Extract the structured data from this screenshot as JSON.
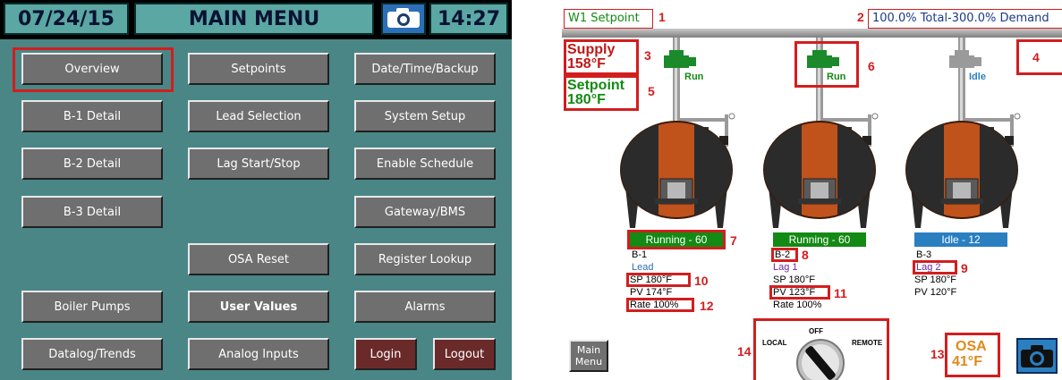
{
  "left_screen": {
    "topbar": {
      "date": "07/24/15",
      "title": "MAIN MENU",
      "camera_icon": "camera-icon",
      "time": "14:27"
    },
    "buttons": {
      "overview": "Overview",
      "setpoints": "Setpoints",
      "date_time_backup": "Date/Time/Backup",
      "b1_detail": "B-1 Detail",
      "lead_selection": "Lead Selection",
      "system_setup": "System Setup",
      "b2_detail": "B-2 Detail",
      "lag_start_stop": "Lag Start/Stop",
      "enable_schedule": "Enable Schedule",
      "b3_detail": "B-3 Detail",
      "gateway_bms": "Gateway/BMS",
      "osa_reset": "OSA Reset",
      "register_lookup": "Register Lookup",
      "boiler_pumps": "Boiler Pumps",
      "user_values": "User Values",
      "alarms": "Alarms",
      "datalog_trends": "Datalog/Trends",
      "analog_inputs": "Analog Inputs",
      "login": "Login",
      "logout": "Logout"
    },
    "selected": "Overview"
  },
  "right_screen": {
    "header_left": "W1 Setpoint",
    "header_right": "100.0% Total-300.0% Demand",
    "supply_label": "Supply",
    "supply_value": "158°F",
    "setpoint_label": "Setpoint",
    "setpoint_value": "180°F",
    "boilers": [
      {
        "valve_state": "Run",
        "status": "Running - 60",
        "status_color": "#138a13",
        "name": "B-1",
        "role": "Lead",
        "role_color": "#2a6fb8",
        "sp": "SP 180°F",
        "pv": "PV 174°F",
        "rate": "Rate 100%"
      },
      {
        "valve_state": "Run",
        "status": "Running - 60",
        "status_color": "#138a13",
        "name": "B-2",
        "role": "Lag 1",
        "role_color": "#6a2a9a",
        "sp": "SP 180°F",
        "pv": "PV 123°F",
        "rate": "Rate 100%"
      },
      {
        "valve_state": "Idle",
        "status": "Idle - 12",
        "status_color": "#2a7fc0",
        "name": "B-3",
        "role": "Lag 2",
        "role_color": "#6a2a9a",
        "sp": "SP 180°F",
        "pv": "PV 120°F",
        "rate": ""
      }
    ],
    "switch": {
      "left": "LOCAL",
      "top": "OFF",
      "right": "REMOTE"
    },
    "osa_label": "OSA",
    "osa_value": "41°F",
    "main_menu_button": "Main\nMenu",
    "annotations": [
      "1",
      "2",
      "3",
      "4",
      "5",
      "6",
      "7",
      "8",
      "9",
      "10",
      "11",
      "12",
      "13",
      "14"
    ]
  },
  "colors": {
    "teal_bg": "#4a8686",
    "teal_box": "#5aa7a3",
    "annotation_red": "#d21e1e",
    "boiler_orange": "#c0521b"
  }
}
